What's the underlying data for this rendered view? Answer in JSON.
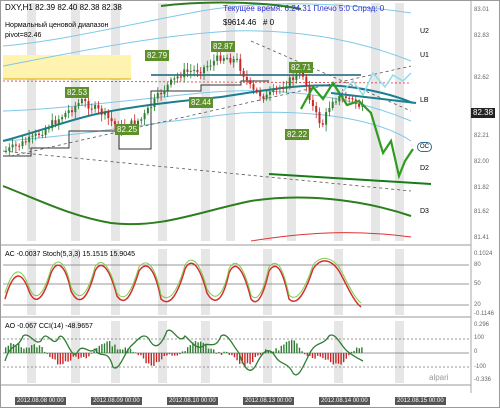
{
  "header": {
    "title": "DXY,H1  82.39 82.40 82.38 82.38",
    "server_time": "Текущее время: 6.24.31 Плечо 5:0  Спрэд: 0",
    "balance": "$9614.46",
    "balance_extra": "# 0"
  },
  "notes": {
    "range_note": "Нормальный ценовой диапазон",
    "pivot": "pivot=82.46"
  },
  "levels": {
    "u2": "U2",
    "u1": "U1",
    "lb": "LB",
    "d2": "D2",
    "d3": "D3",
    "oc": "OC"
  },
  "price_labels": [
    "82.87",
    "82.79",
    "82.71",
    "82.53",
    "82.44",
    "82.25",
    "82.22"
  ],
  "last_price": "82.38",
  "price_axis": [
    "83.01",
    "82.83",
    "82.62",
    "82.41",
    "82.21",
    "82.00",
    "81.82",
    "81.62",
    "81.41"
  ],
  "stoch_panel": {
    "title": "AC -0.0037  Stoch(5,3,3) 15.1515 15.9045",
    "axis": [
      "0.1024",
      "80",
      "50",
      "20",
      "-0.1146"
    ]
  },
  "ao_panel": {
    "title": "AO -0.067  CCI(14) -48.9657",
    "axis": [
      "0.296",
      "100",
      "0",
      "-100",
      "-0.336"
    ]
  },
  "dates": [
    "2012.08.08 00:00",
    "2012.08.09 00:00",
    "2012.08.10 00:00",
    "2012.08.13 00:00",
    "2012.08.14 00:00",
    "2012.08.15 00:00"
  ],
  "brand": "alpari",
  "colors": {
    "bull": "#2e7d32",
    "bear": "#c62828",
    "pivot_zone": "#fff3b0",
    "level_line": "#1a7a1a",
    "forecast": "#2e9d1e"
  }
}
